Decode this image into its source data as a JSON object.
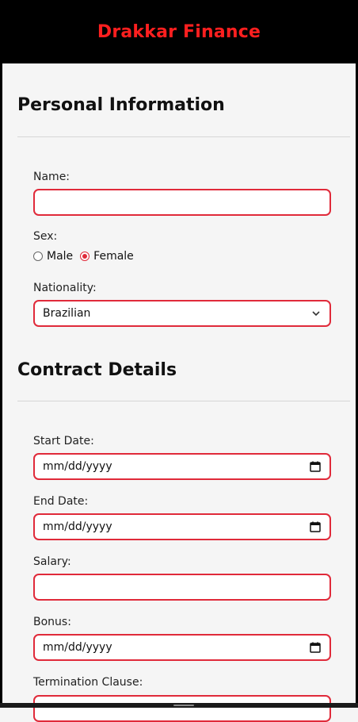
{
  "header": {
    "title": "Drakkar Finance"
  },
  "personal": {
    "title": "Personal Information",
    "name_label": "Name:",
    "name_value": "",
    "sex_label": "Sex:",
    "sex_options": [
      "Male",
      "Female"
    ],
    "sex_selected": "Female",
    "nationality_label": "Nationality:",
    "nationality_value": "Brazilian"
  },
  "contract": {
    "title": "Contract Details",
    "start_label": "Start Date:",
    "start_value": "mm/dd/yyyy",
    "end_label": "End Date:",
    "end_value": "mm/dd/yyyy",
    "salary_label": "Salary:",
    "salary_value": "",
    "bonus_label": "Bonus:",
    "bonus_value": "mm/dd/yyyy",
    "termination_label": "Termination Clause:"
  },
  "colors": {
    "brand": "#ff1f1f",
    "accent_border": "#e02a3a",
    "header_bg": "#000000",
    "page_bg": "#f5f5f5"
  },
  "icons": {
    "date": "calendar-icon",
    "select": "chevron-down-icon"
  }
}
